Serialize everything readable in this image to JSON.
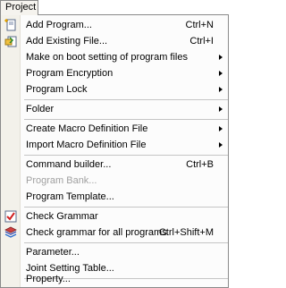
{
  "menubar": {
    "title": "Project"
  },
  "menu": {
    "items": [
      {
        "label": "Add Program...",
        "shortcut": "Ctrl+N"
      },
      {
        "label": "Add Existing File...",
        "shortcut": "Ctrl+I"
      },
      {
        "label": "Make on boot setting of program files"
      },
      {
        "label": "Program Encryption"
      },
      {
        "label": "Program Lock"
      },
      {
        "label": "Folder"
      },
      {
        "label": "Create Macro Definition File"
      },
      {
        "label": "Import Macro Definition File"
      },
      {
        "label": "Command builder...",
        "shortcut": "Ctrl+B"
      },
      {
        "label": "Program Bank..."
      },
      {
        "label": "Program Template..."
      },
      {
        "label": "Check Grammar"
      },
      {
        "label": "Check grammar for all programs",
        "shortcut": "Ctrl+Shift+M"
      },
      {
        "label": "Parameter..."
      },
      {
        "label": "Joint Setting Table..."
      },
      {
        "label": "Property..."
      }
    ]
  }
}
